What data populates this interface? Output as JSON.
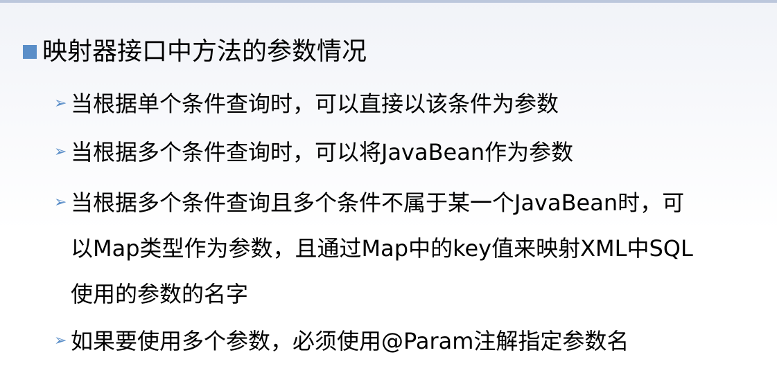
{
  "heading": {
    "bullet_icon": "square-bullet-icon",
    "text": "映射器接口中方法的参数情况"
  },
  "items": [
    {
      "bullet_icon": "arrow-bullet-icon",
      "text": "当根据单个条件查询时，可以直接以该条件为参数"
    },
    {
      "bullet_icon": "arrow-bullet-icon",
      "text": "当根据多个条件查询时，可以将JavaBean作为参数"
    },
    {
      "bullet_icon": "arrow-bullet-icon",
      "lines": [
        "当根据多个条件查询且多个条件不属于某一个JavaBean时，可",
        "以Map类型作为参数，且通过Map中的key值来映射XML中SQL",
        "使用的参数的名字"
      ]
    },
    {
      "bullet_icon": "arrow-bullet-icon",
      "text": "如果要使用多个参数，必须使用@Param注解指定参数名"
    }
  ],
  "colors": {
    "bullet": "#5a8ec8",
    "top_bar": "#bcc7dc",
    "text": "#000000"
  }
}
